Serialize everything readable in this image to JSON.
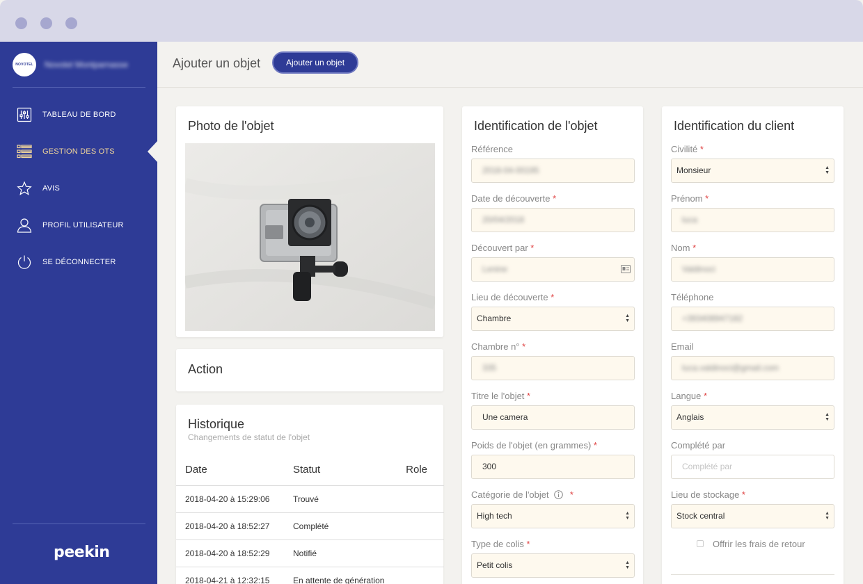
{
  "sidebar": {
    "logo_text": "NOVOTEL",
    "hotel_name": "Novotel Montparnasse",
    "items": [
      {
        "label": "TABLEAU DE BORD",
        "icon": "sliders-icon"
      },
      {
        "label": "GESTION DES OTS",
        "icon": "list-icon",
        "active": true
      },
      {
        "label": "AVIS",
        "icon": "star-icon"
      },
      {
        "label": "PROFIL UTILISATEUR",
        "icon": "user-icon"
      },
      {
        "label": "SE DÉCONNECTER",
        "icon": "power-icon"
      }
    ],
    "footer_logo": "peekin"
  },
  "header": {
    "title": "Ajouter un objet",
    "button_label": "Ajouter un objet"
  },
  "photo_card": {
    "title": "Photo de l'objet"
  },
  "action_card": {
    "title": "Action"
  },
  "history_card": {
    "title": "Historique",
    "subtitle": "Changements de statut de l'objet",
    "columns": [
      "Date",
      "Statut",
      "Role"
    ],
    "rows": [
      {
        "date": "2018-04-20 à 15:29:06",
        "status": "Trouvé",
        "role": ""
      },
      {
        "date": "2018-04-20 à 18:52:27",
        "status": "Complété",
        "role": ""
      },
      {
        "date": "2018-04-20 à 18:52:29",
        "status": "Notifié",
        "role": ""
      },
      {
        "date": "2018-04-21 à 12:32:15",
        "status": "En attente de génération",
        "role": ""
      }
    ]
  },
  "object_card": {
    "title": "Identification de l'objet",
    "fields": {
      "reference": {
        "label": "Référence",
        "value": "2018-04-00195"
      },
      "date": {
        "label": "Date de découverte",
        "value": "20/04/2018"
      },
      "found_by": {
        "label": "Découvert par",
        "value": "Lenine"
      },
      "place": {
        "label": "Lieu de découverte",
        "value": "Chambre"
      },
      "room": {
        "label": "Chambre n°",
        "value": "335"
      },
      "title": {
        "label": "Titre le l'objet",
        "value": "Une camera"
      },
      "weight": {
        "label": "Poids de l'objet (en grammes)",
        "value": "300"
      },
      "category": {
        "label": "Catégorie de l'objet",
        "value": "High tech"
      },
      "package": {
        "label": "Type de colis",
        "value": "Petit colis"
      }
    }
  },
  "client_card": {
    "title": "Identification du client",
    "fields": {
      "civility": {
        "label": "Civilité",
        "value": "Monsieur"
      },
      "firstname": {
        "label": "Prénom",
        "value": "luca"
      },
      "lastname": {
        "label": "Nom",
        "value": "Valdinoci"
      },
      "phone": {
        "label": "Téléphone",
        "value": "+393408947182"
      },
      "email": {
        "label": "Email",
        "value": "luca.valdinoci@gmail.com"
      },
      "language": {
        "label": "Langue",
        "value": "Anglais"
      },
      "completed_by": {
        "label": "Complété par",
        "placeholder": "Complété par"
      },
      "storage": {
        "label": "Lieu de stockage",
        "value": "Stock central"
      }
    },
    "offer_checkbox_label": "Offrir les frais de retour"
  }
}
